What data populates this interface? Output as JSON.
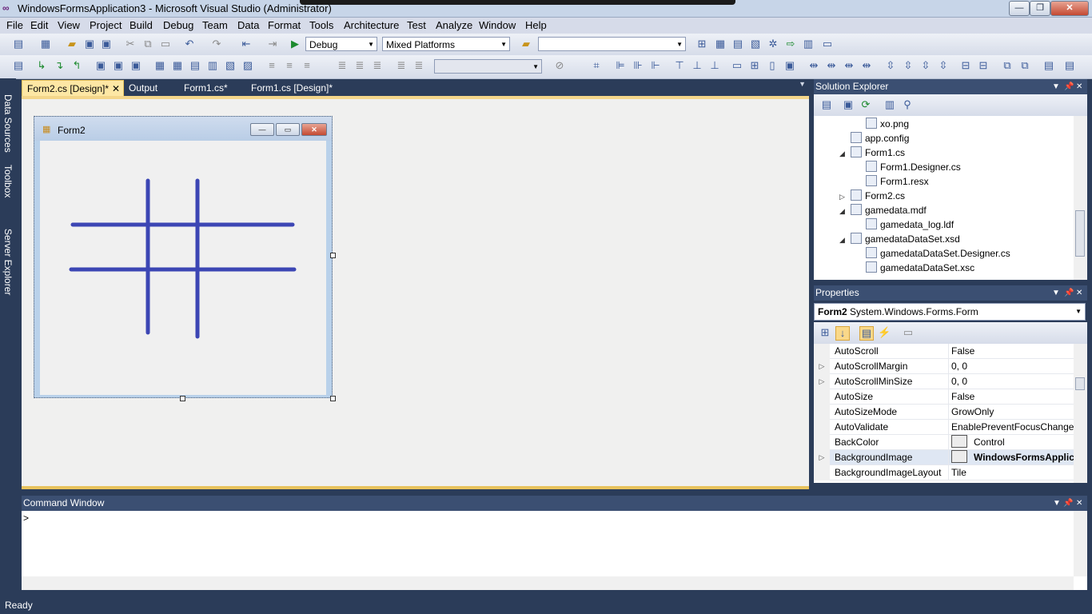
{
  "window": {
    "title": "WindowsFormsApplication3 - Microsoft Visual Studio (Administrator)"
  },
  "menu": [
    "File",
    "Edit",
    "View",
    "Project",
    "Build",
    "Debug",
    "Team",
    "Data",
    "Format",
    "Tools",
    "Architecture",
    "Test",
    "Analyze",
    "Window",
    "Help"
  ],
  "toolbar": {
    "config": "Debug",
    "platform": "Mixed Platforms",
    "find": ""
  },
  "sidebar": [
    "Data Sources",
    "Toolbox",
    "Server Explorer"
  ],
  "tabs": [
    {
      "label": "Form2.cs [Design]*",
      "active": true
    },
    {
      "label": "Output",
      "active": false
    },
    {
      "label": "Form1.cs*",
      "active": false
    },
    {
      "label": "Form1.cs [Design]*",
      "active": false
    }
  ],
  "form": {
    "title": "Form2",
    "line_color": "#3c46b4"
  },
  "command_window": {
    "title": "Command Window",
    "prompt": ">"
  },
  "solution_explorer": {
    "title": "Solution Explorer",
    "items": [
      {
        "label": "xo.png",
        "indent": 3,
        "exp": ""
      },
      {
        "label": "app.config",
        "indent": 2,
        "exp": ""
      },
      {
        "label": "Form1.cs",
        "indent": 2,
        "exp": "◢"
      },
      {
        "label": "Form1.Designer.cs",
        "indent": 3,
        "exp": ""
      },
      {
        "label": "Form1.resx",
        "indent": 3,
        "exp": ""
      },
      {
        "label": "Form2.cs",
        "indent": 2,
        "exp": "▷"
      },
      {
        "label": "gamedata.mdf",
        "indent": 2,
        "exp": "◢"
      },
      {
        "label": "gamedata_log.ldf",
        "indent": 3,
        "exp": ""
      },
      {
        "label": "gamedataDataSet.xsd",
        "indent": 2,
        "exp": "◢"
      },
      {
        "label": "gamedataDataSet.Designer.cs",
        "indent": 3,
        "exp": ""
      },
      {
        "label": "gamedataDataSet.xsc",
        "indent": 3,
        "exp": ""
      }
    ]
  },
  "properties": {
    "title": "Properties",
    "object_name": "Form2",
    "object_type": "System.Windows.Forms.Form",
    "rows": [
      {
        "name": "AutoScroll",
        "value": "False",
        "exp": false,
        "sel": false
      },
      {
        "name": "AutoScrollMargin",
        "value": "0, 0",
        "exp": true,
        "sel": false
      },
      {
        "name": "AutoScrollMinSize",
        "value": "0, 0",
        "exp": true,
        "sel": false
      },
      {
        "name": "AutoSize",
        "value": "False",
        "exp": false,
        "sel": false
      },
      {
        "name": "AutoSizeMode",
        "value": "GrowOnly",
        "exp": false,
        "sel": false
      },
      {
        "name": "AutoValidate",
        "value": "EnablePreventFocusChange",
        "exp": false,
        "sel": false
      },
      {
        "name": "BackColor",
        "value": "Control",
        "exp": false,
        "sel": false,
        "swatch": true
      },
      {
        "name": "BackgroundImage",
        "value": "WindowsFormsApplica",
        "exp": true,
        "sel": true,
        "swatch": true,
        "bold": true
      },
      {
        "name": "BackgroundImageLayout",
        "value": "Tile",
        "exp": false,
        "sel": false
      }
    ]
  },
  "status": {
    "text": "Ready"
  }
}
